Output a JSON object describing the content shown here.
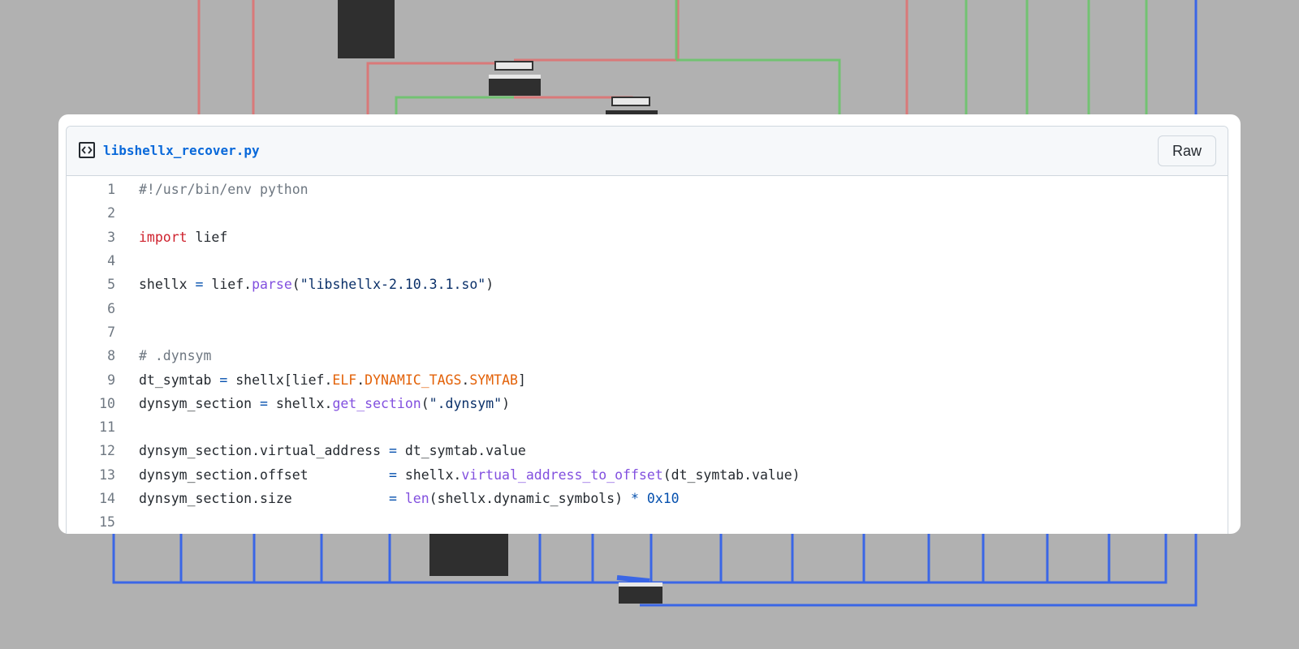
{
  "theme": {
    "background": "#b1b1b1",
    "red_wire": "#e06c6c",
    "green_wire": "#6cc46c",
    "blue_wire": "#2a5ee8",
    "link": "#0969da"
  },
  "file": {
    "icon": "code-file-icon",
    "name": "libshellx_recover.py",
    "raw_label": "Raw"
  },
  "code": {
    "lines": [
      {
        "n": "1",
        "tokens": [
          {
            "t": "#!/usr/bin/env python",
            "c": "c-com"
          }
        ]
      },
      {
        "n": "2",
        "tokens": []
      },
      {
        "n": "3",
        "tokens": [
          {
            "t": "import",
            "c": "c-kw"
          },
          {
            "t": " lief",
            "c": ""
          }
        ]
      },
      {
        "n": "4",
        "tokens": []
      },
      {
        "n": "5",
        "tokens": [
          {
            "t": "shellx ",
            "c": ""
          },
          {
            "t": "=",
            "c": "c-op"
          },
          {
            "t": " lief.",
            "c": ""
          },
          {
            "t": "parse",
            "c": "c-fn"
          },
          {
            "t": "(",
            "c": ""
          },
          {
            "t": "\"libshellx-2.10.3.1.so\"",
            "c": "c-str"
          },
          {
            "t": ")",
            "c": ""
          }
        ]
      },
      {
        "n": "6",
        "tokens": []
      },
      {
        "n": "7",
        "tokens": []
      },
      {
        "n": "8",
        "tokens": [
          {
            "t": "# .dynsym",
            "c": "c-com"
          }
        ]
      },
      {
        "n": "9",
        "tokens": [
          {
            "t": "dt_symtab ",
            "c": ""
          },
          {
            "t": "=",
            "c": "c-op"
          },
          {
            "t": " shellx[lief.",
            "c": ""
          },
          {
            "t": "ELF",
            "c": "c-const"
          },
          {
            "t": ".",
            "c": ""
          },
          {
            "t": "DYNAMIC_TAGS",
            "c": "c-const"
          },
          {
            "t": ".",
            "c": ""
          },
          {
            "t": "SYMTAB",
            "c": "c-const"
          },
          {
            "t": "]",
            "c": ""
          }
        ]
      },
      {
        "n": "10",
        "tokens": [
          {
            "t": "dynsym_section ",
            "c": ""
          },
          {
            "t": "=",
            "c": "c-op"
          },
          {
            "t": " shellx.",
            "c": ""
          },
          {
            "t": "get_section",
            "c": "c-fn"
          },
          {
            "t": "(",
            "c": ""
          },
          {
            "t": "\".dynsym\"",
            "c": "c-str"
          },
          {
            "t": ")",
            "c": ""
          }
        ]
      },
      {
        "n": "11",
        "tokens": []
      },
      {
        "n": "12",
        "tokens": [
          {
            "t": "dynsym_section.virtual_address ",
            "c": ""
          },
          {
            "t": "=",
            "c": "c-op"
          },
          {
            "t": " dt_symtab.value",
            "c": ""
          }
        ]
      },
      {
        "n": "13",
        "tokens": [
          {
            "t": "dynsym_section.offset          ",
            "c": ""
          },
          {
            "t": "=",
            "c": "c-op"
          },
          {
            "t": " shellx.",
            "c": ""
          },
          {
            "t": "virtual_address_to_offset",
            "c": "c-fn"
          },
          {
            "t": "(dt_symtab.value)",
            "c": ""
          }
        ]
      },
      {
        "n": "14",
        "tokens": [
          {
            "t": "dynsym_section.size            ",
            "c": ""
          },
          {
            "t": "=",
            "c": "c-op"
          },
          {
            "t": " ",
            "c": ""
          },
          {
            "t": "len",
            "c": "c-fn"
          },
          {
            "t": "(shellx.dynamic_symbols) ",
            "c": ""
          },
          {
            "t": "*",
            "c": "c-op"
          },
          {
            "t": " ",
            "c": ""
          },
          {
            "t": "0x10",
            "c": "c-num"
          }
        ]
      },
      {
        "n": "15",
        "tokens": []
      }
    ]
  }
}
